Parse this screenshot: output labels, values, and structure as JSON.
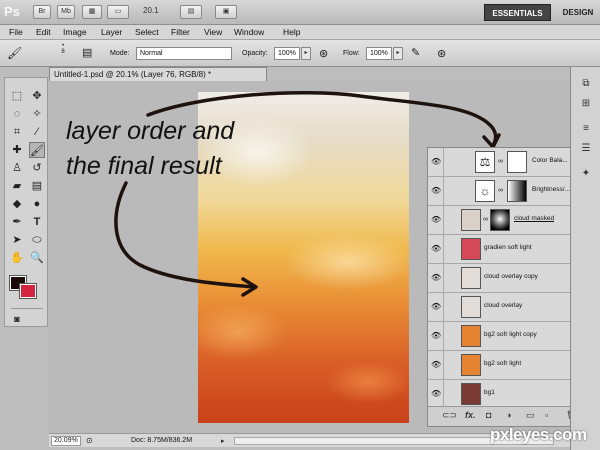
{
  "app": {
    "logo": "Ps",
    "zoom": "20.1",
    "workspace_active": "ESSENTIALS",
    "workspace_other": "DESIGN",
    "btn_br": "Br",
    "btn_mb": "Mb"
  },
  "menu": [
    "File",
    "Edit",
    "Image",
    "Layer",
    "Select",
    "Filter",
    "View",
    "Window",
    "Help"
  ],
  "options": {
    "brush_size": "8",
    "mode_label": "Mode:",
    "mode_value": "Normal",
    "opacity_label": "Opacity:",
    "opacity_value": "100%",
    "flow_label": "Flow:",
    "flow_value": "100%"
  },
  "document": {
    "tab_title": "Untitled-1.psd @ 20.1% (Layer 76, RGB/8) *"
  },
  "annotation": {
    "line1": "layer order and",
    "line2": "the final result"
  },
  "status": {
    "zoom": "20.09%",
    "doc_info": "Doc: 8.75M/836.2M"
  },
  "layers": [
    {
      "name": "Color Bala...",
      "type": "adjustment-balance",
      "thumb": "#ffffff"
    },
    {
      "name": "Brightness/...",
      "type": "adjustment-brightness",
      "thumb": "#ffffff"
    },
    {
      "name": "cloud masked",
      "type": "masked",
      "thumb": "#d9d0c8"
    },
    {
      "name": "gradien soft light",
      "type": "pixel",
      "thumb": "#d64a58"
    },
    {
      "name": "cloud overlay copy",
      "type": "pixel",
      "thumb": "#e2ddd8"
    },
    {
      "name": "cloud overlay",
      "type": "pixel",
      "thumb": "#e2ddd8"
    },
    {
      "name": "bg2 sofr light copy",
      "type": "pixel",
      "thumb": "#e48433"
    },
    {
      "name": "bg2 sofr light",
      "type": "pixel",
      "thumb": "#e48433"
    },
    {
      "name": "bg1",
      "type": "pixel",
      "thumb": "#7a3b35"
    }
  ],
  "colors": {
    "foreground": "#1a0a0a",
    "background": "#d2233f"
  },
  "watermark": "pxleyes.com"
}
